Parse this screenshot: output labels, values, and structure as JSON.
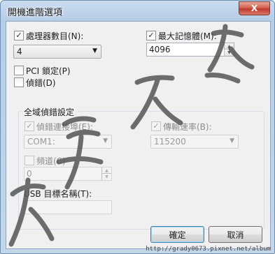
{
  "window": {
    "title": "開機進階選項",
    "close_glyph": "X"
  },
  "cpu": {
    "label": "處理器數目(N):",
    "checked": true,
    "value": "4"
  },
  "memory": {
    "label": "最大記憶體(M):",
    "checked": true,
    "value": "4096"
  },
  "pci_lock": {
    "label": "PCI 鎖定(P)",
    "checked": false
  },
  "debug": {
    "label": "偵錯(D)",
    "checked": false
  },
  "global_debug": {
    "title": "全域偵錯設定",
    "debug_port": {
      "label": "偵錯連接埠(E):",
      "checked": true,
      "value": "COM1:"
    },
    "baud_rate": {
      "label": "傳輸速率(B):",
      "checked": true,
      "value": "115200"
    },
    "channel": {
      "label": "頻道(C)",
      "checked": false,
      "value": "0"
    },
    "usb_target": {
      "label": "USB 目標名稱(T):",
      "value": ""
    }
  },
  "buttons": {
    "ok": "確定",
    "cancel": "取消"
  },
  "footer": {
    "url": "http://grady0673.pixnet.net/album"
  },
  "icons": {
    "check": "✓",
    "dropdown": "▼",
    "spin_up": "▲",
    "spin_down": "▼"
  },
  "colors": {
    "title_bar": "#b6cde6",
    "close": "#c0392b",
    "watermark": "#555555"
  }
}
